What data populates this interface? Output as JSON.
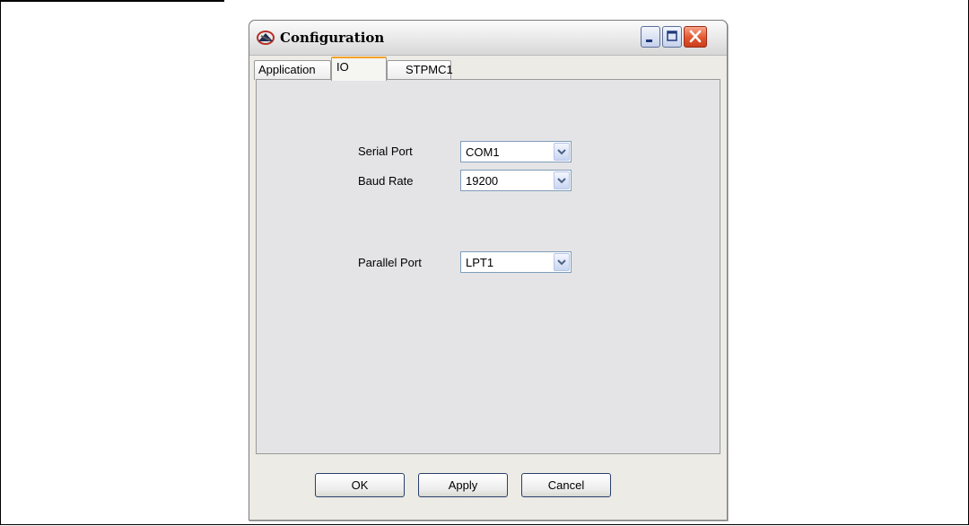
{
  "window": {
    "title": "Configuration"
  },
  "tabs": [
    {
      "label": "Application"
    },
    {
      "label": "IO",
      "active": true
    },
    {
      "label": "STPMC1"
    }
  ],
  "io_panel": {
    "serial_port": {
      "label": "Serial Port",
      "value": "COM1"
    },
    "baud_rate": {
      "label": "Baud Rate",
      "value": "19200"
    },
    "parallel_port": {
      "label": "Parallel Port",
      "value": "LPT1"
    }
  },
  "buttons": {
    "ok": "OK",
    "apply": "Apply",
    "cancel": "Cancel"
  },
  "icons": {
    "app": "configuration-app-icon",
    "minimize": "minimize-icon",
    "maximize": "maximize-icon",
    "close": "close-icon",
    "dropdown": "chevron-down-icon"
  },
  "colors": {
    "tab_accent": "#f0a32e",
    "close_button": "#e3552e"
  }
}
